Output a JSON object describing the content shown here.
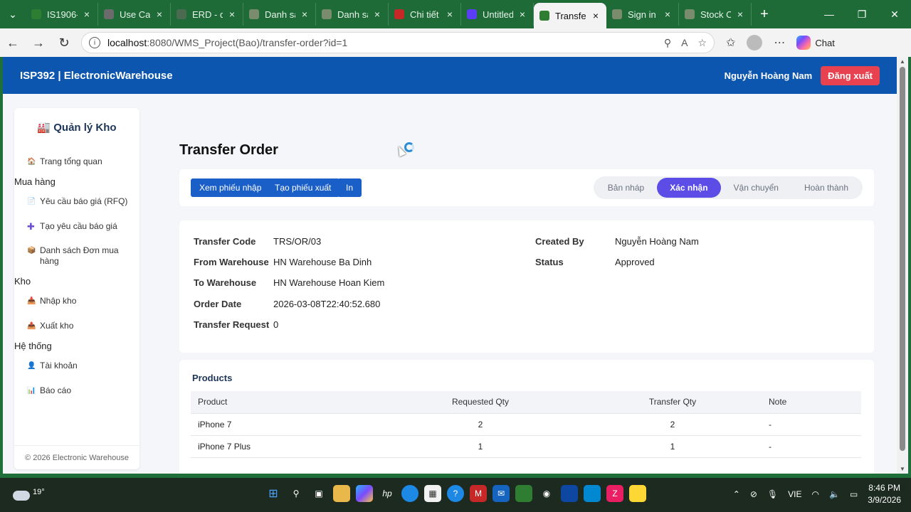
{
  "browser": {
    "tabs": [
      {
        "title": "IS1906-I",
        "color": "#2e7d32"
      },
      {
        "title": "Use Case",
        "color": "#6b6b6b"
      },
      {
        "title": "ERD - di",
        "color": "#4a6b4f"
      },
      {
        "title": "Danh sá",
        "color": "#7a8c6e"
      },
      {
        "title": "Danh sá",
        "color": "#7a8c6e"
      },
      {
        "title": "Chi tiết",
        "color": "#c62828"
      },
      {
        "title": "Untitled",
        "color": "#5b3df5"
      },
      {
        "title": "Transfer",
        "color": "#2e7d32",
        "active": true
      },
      {
        "title": "Sign in",
        "color": "#7a8c6e"
      },
      {
        "title": "Stock O",
        "color": "#7a8c6e"
      }
    ],
    "url_host": "localhost",
    "url_rest": ":8080/WMS_Project(Bao)/transfer-order?id=1",
    "chat_label": "Chat"
  },
  "header": {
    "brand": "ISP392 | ElectronicWarehouse",
    "user_name": "Nguyễn Hoàng Nam",
    "logout_label": "Đăng xuất"
  },
  "sidebar": {
    "title": "🏭 Quản lý Kho",
    "dashboard": "Trang tổng quan",
    "group_purchase": "Mua hàng",
    "rfq": "Yêu cầu báo giá (RFQ)",
    "create_rfq": "Tạo yêu cầu báo giá",
    "po_list": "Danh sách Đơn mua hàng",
    "group_warehouse": "Kho",
    "import": "Nhập kho",
    "export": "Xuất kho",
    "group_system": "Hệ thống",
    "account": "Tài khoản",
    "report": "Báo cáo",
    "footer": "© 2026 Electronic Warehouse"
  },
  "page": {
    "title": "Transfer Order",
    "buttons": {
      "view_import": "Xem phiếu nhập",
      "create_export": "Tạo phiếu xuất",
      "print": "In"
    },
    "steps": [
      "Bản nháp",
      "Xác nhận",
      "Vận chuyển",
      "Hoàn thành"
    ],
    "active_step": 1,
    "info": {
      "transfer_code_label": "Transfer Code",
      "transfer_code": "TRS/OR/03",
      "from_label": "From Warehouse",
      "from": "HN Warehouse Ba Dinh",
      "to_label": "To Warehouse",
      "to": "HN Warehouse Hoan Kiem",
      "date_label": "Order Date",
      "date": "2026-03-08T22:40:52.680",
      "request_label": "Transfer Request",
      "request": "0",
      "created_by_label": "Created By",
      "created_by": "Nguyễn Hoàng Nam",
      "status_label": "Status",
      "status": "Approved"
    },
    "products": {
      "title": "Products",
      "headers": [
        "Product",
        "Requested Qty",
        "Transfer Qty",
        "Note"
      ],
      "rows": [
        [
          "iPhone 7",
          "2",
          "2",
          "-"
        ],
        [
          "iPhone 7 Plus",
          "1",
          "1",
          "-"
        ]
      ]
    }
  },
  "taskbar": {
    "temperature": "19°",
    "language": "VIE",
    "time": "8:46 PM",
    "date": "3/9/2026"
  }
}
